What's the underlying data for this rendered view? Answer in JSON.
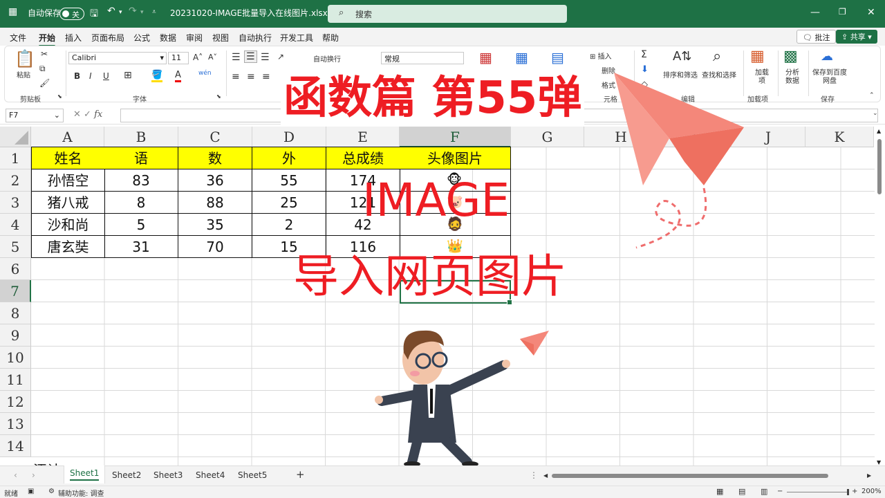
{
  "titlebar": {
    "autosave_label": "自动保存",
    "autosave_state": "关",
    "filename": "20231020-IMAGE批量导入在线图片.xlsx",
    "search_placeholder": "搜索"
  },
  "menu": {
    "items": [
      "文件",
      "开始",
      "插入",
      "页面布局",
      "公式",
      "数据",
      "审阅",
      "视图",
      "自动执行",
      "开发工具",
      "帮助"
    ],
    "active": "开始",
    "comment_button": "批注",
    "share_button": "共享"
  },
  "ribbon": {
    "paste": "粘贴",
    "clipboard_group": "剪贴板",
    "font_name": "Calibri",
    "font_size": "11",
    "font_group": "字体",
    "wrap_text": "自动换行",
    "number_format": "常规",
    "insert": "插入",
    "delete": "删除",
    "format": "格式",
    "cells_group_partial": "元格",
    "sort_filter": "排序和筛选",
    "find_select": "查找和选择",
    "edit_group": "编辑",
    "addins": "加载项",
    "addins_group": "加载项",
    "analyze": "分析数据",
    "save_baidu": "保存到百度网盘",
    "save_group": "保存"
  },
  "formula_bar": {
    "name_box": "F7",
    "fx": "fx"
  },
  "sheet": {
    "columns": [
      "A",
      "B",
      "C",
      "D",
      "E",
      "F",
      "G",
      "H",
      "I",
      "J",
      "K"
    ],
    "selected_column": "F",
    "rows": [
      "1",
      "2",
      "3",
      "4",
      "5",
      "6",
      "7",
      "8",
      "9",
      "10",
      "11",
      "12",
      "13",
      "14"
    ],
    "selected_row": "7",
    "headers": [
      "姓名",
      "语",
      "数",
      "外",
      "总成绩",
      "头像图片"
    ],
    "data": [
      [
        "孙悟空",
        "83",
        "36",
        "55",
        "174"
      ],
      [
        "猪八戒",
        "8",
        "88",
        "25",
        "121"
      ],
      [
        "沙和尚",
        "5",
        "35",
        "2",
        "42"
      ],
      [
        "唐玄奘",
        "31",
        "70",
        "15",
        "116"
      ]
    ],
    "avatars": [
      "🐵",
      "🐷",
      "🧔",
      "👑"
    ],
    "partial_row_text": "添计"
  },
  "overlay": {
    "title": "函数篇 第55弹",
    "subtitle": "IMAGE",
    "caption": "导入网页图片"
  },
  "tabs": {
    "sheets": [
      "Sheet1",
      "Sheet2",
      "Sheet3",
      "Sheet4",
      "Sheet5"
    ],
    "active": "Sheet1",
    "add": "+"
  },
  "status": {
    "ready": "就绪",
    "accessibility": "辅助功能: 调查",
    "zoom": "200%"
  },
  "colors": {
    "excel_green": "#1e7145",
    "header_yellow": "#ffff00",
    "overlay_red": "#ee1d23",
    "plane_pink": "#f4877a"
  }
}
